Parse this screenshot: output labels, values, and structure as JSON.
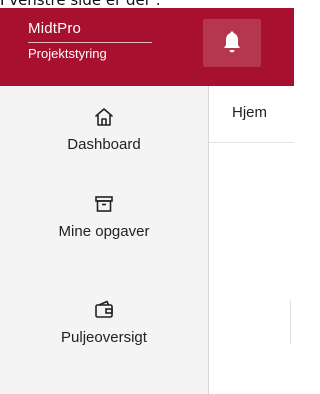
{
  "top_fragment": "I venstre side er der :",
  "header": {
    "logo_title": "MidtPro",
    "logo_subtitle": "Projektstyring",
    "notifications_icon": "bell-icon",
    "brand_color": "#a8102f"
  },
  "sidebar": {
    "items": [
      {
        "label": "Dashboard",
        "icon": "home-icon"
      },
      {
        "label": "Mine opgaver",
        "icon": "archive-box-icon"
      },
      {
        "label": "Puljeoversigt",
        "icon": "wallet-icon"
      }
    ]
  },
  "main": {
    "tabs": [
      {
        "label": "Hjem"
      }
    ]
  }
}
